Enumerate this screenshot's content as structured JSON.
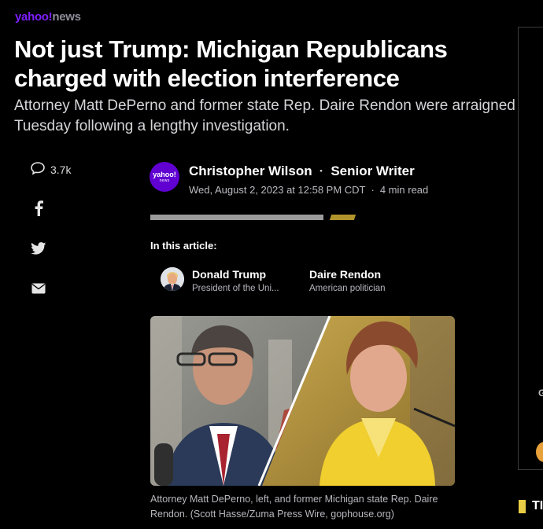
{
  "brand": {
    "yahoo": "yahoo!",
    "section": "news"
  },
  "article": {
    "headline": "Not just Trump: Michigan Republicans charged with election interference",
    "subhead": "Attorney Matt DePerno and former state Rep. Daire Rendon were arraigned Tuesday following a lengthy investigation.",
    "comments_count": "3.7k",
    "author": "Christopher Wilson",
    "author_title": "Senior Writer",
    "date": "Wed, August 2, 2023 at 12:58 PM CDT",
    "read_time": "4 min read",
    "publisher_avatar": {
      "line1": "yahoo!",
      "line2": "news"
    }
  },
  "share": {
    "icons": [
      "comment-icon",
      "facebook-icon",
      "twitter-icon",
      "email-icon"
    ]
  },
  "in_this_article": {
    "label": "In this article:",
    "entities": [
      {
        "name": "Donald Trump",
        "description": "President of the Uni..."
      },
      {
        "name": "Daire Rendon",
        "description": "American politician"
      }
    ]
  },
  "photo": {
    "caption": "Attorney Matt DePerno, left, and former Michigan state Rep. Daire Rendon. (Scott Hasse/Zuma Press Wire, gophouse.org)"
  },
  "right_rail": {
    "partial_letter": "G",
    "partial_heading": "TI"
  },
  "colors": {
    "accent": "#b1932c",
    "brand_purple": "#6001d2",
    "background": "#000000"
  }
}
